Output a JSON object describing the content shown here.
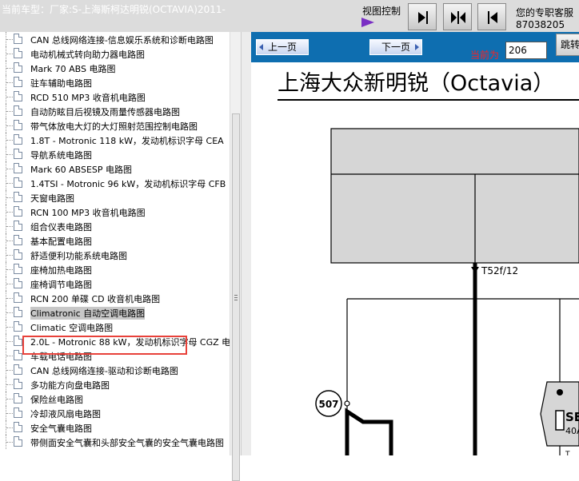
{
  "header": {
    "car_label": "当前车型：厂家:S-上海斯柯达明锐(OCTAVIA)2011-",
    "view_control_label": "视图控制",
    "contact_line1": "您的专职客服",
    "contact_line2": "87038205"
  },
  "tree": {
    "items": [
      {
        "label": "CAN 总线网络连接-信息娱乐系统和诊断电路图"
      },
      {
        "label": "电动机械式转向助力器电路图"
      },
      {
        "label": "Mark 70 ABS 电路图"
      },
      {
        "label": "驻车辅助电路图"
      },
      {
        "label": "RCD 510 MP3 收音机电路图"
      },
      {
        "label": "自动防眩目后视镜及雨量传感器电路图"
      },
      {
        "label": "带气体放电大灯的大灯照射范围控制电路图"
      },
      {
        "label": "1.8T - Motronic 118 kW，发动机标识字母 CEA"
      },
      {
        "label": "导航系统电路图"
      },
      {
        "label": "Mark 60 ABSESP 电路图"
      },
      {
        "label": "1.4TSI - Motronic 96 kW，发动机标识字母 CFB"
      },
      {
        "label": "天窗电路图"
      },
      {
        "label": "RCN 100 MP3 收音机电路图"
      },
      {
        "label": "组合仪表电路图"
      },
      {
        "label": "基本配置电路图"
      },
      {
        "label": "舒适便利功能系统电路图"
      },
      {
        "label": "座椅加热电路图"
      },
      {
        "label": "座椅调节电路图"
      },
      {
        "label": "RCN 200 单碟 CD 收音机电路图"
      },
      {
        "label": "Climatronic 自动空调电路图",
        "selected": true
      },
      {
        "label": "Climatic 空调电路图"
      },
      {
        "label": "2.0L - Motronic 88 kW，发动机标识字母 CGZ 电"
      },
      {
        "label": "车载电话电路图"
      },
      {
        "label": "CAN 总线网络连接-驱动和诊断电路图"
      },
      {
        "label": "多功能方向盘电路图"
      },
      {
        "label": "保险丝电路图"
      },
      {
        "label": "冷却液风扇电路图"
      },
      {
        "label": "安全气囊电路图"
      },
      {
        "label": "带侧面安全气囊和头部安全气囊的安全气囊电路图"
      }
    ]
  },
  "toolbar": {
    "prev_label": "上一页",
    "next_label": "下一页",
    "current_label": "当前为",
    "page_number": "206",
    "jump_label": "跳转"
  },
  "document": {
    "title": "上海大众新明锐（Octavia）",
    "connector_label": "T52f/12",
    "node_label": "507",
    "component_label": "SE",
    "component_sub": "40A",
    "fuse_partial": "T"
  },
  "colors": {
    "toolbar_bg": "#0e6eb0",
    "highlight_box": "#e8413a",
    "view_arrow": "#7a2fc4",
    "current_label": "#ff2020"
  }
}
